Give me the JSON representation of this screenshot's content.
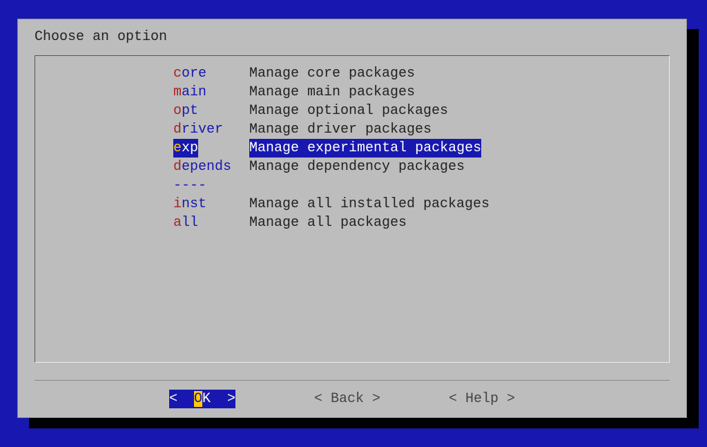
{
  "dialog": {
    "title": "Choose an option"
  },
  "menu": {
    "items": [
      {
        "hotkey": "c",
        "rest": "ore",
        "desc": "Manage core packages",
        "selected": false
      },
      {
        "hotkey": "m",
        "rest": "ain",
        "desc": "Manage main packages",
        "selected": false
      },
      {
        "hotkey": "o",
        "rest": "pt",
        "desc": "Manage optional packages",
        "selected": false
      },
      {
        "hotkey": "d",
        "rest": "river",
        "desc": "Manage driver packages",
        "selected": false
      },
      {
        "hotkey": "e",
        "rest": "xp",
        "desc": "Manage experimental packages",
        "selected": true
      },
      {
        "hotkey": "d",
        "rest": "epends",
        "desc": "Manage dependency packages",
        "selected": false
      }
    ],
    "separator": "----",
    "items2": [
      {
        "hotkey": "i",
        "rest": "nst",
        "desc": "Manage all installed packages",
        "selected": false
      },
      {
        "hotkey": "a",
        "rest": "ll",
        "desc": "Manage all packages",
        "selected": false
      }
    ]
  },
  "buttons": {
    "ok": {
      "bracket_l": "<  ",
      "hotkey": "O",
      "rest": "K",
      "bracket_r": "  >"
    },
    "back": "< Back >",
    "help": "< Help >"
  }
}
